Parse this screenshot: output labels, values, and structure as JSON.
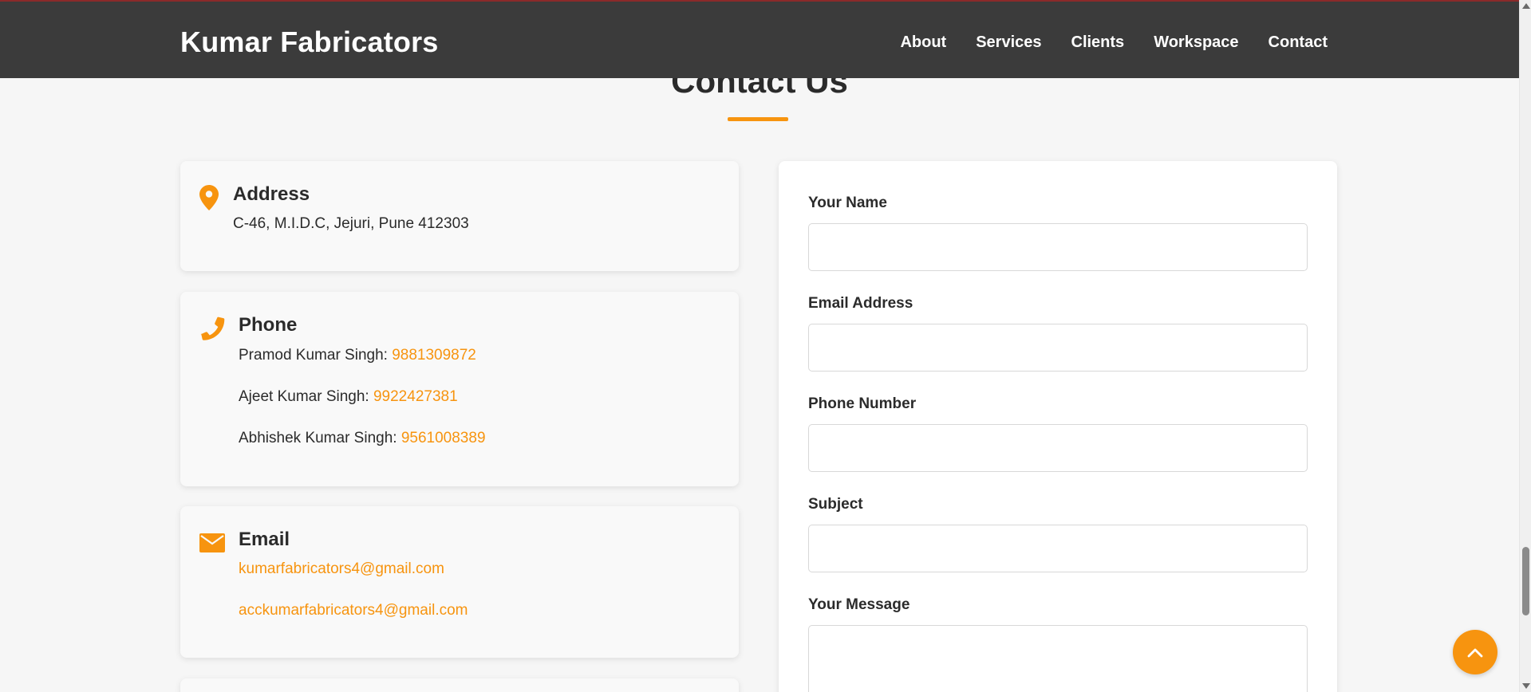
{
  "header": {
    "brand": "Kumar Fabricators",
    "nav": [
      "About",
      "Services",
      "Clients",
      "Workspace",
      "Contact"
    ]
  },
  "section": {
    "title": "Contact Us"
  },
  "address": {
    "title": "Address",
    "text": "C-46, M.I.D.C, Jejuri, Pune 412303"
  },
  "phone": {
    "title": "Phone",
    "entries": [
      {
        "name": "Pramod Kumar Singh:",
        "number": "9881309872"
      },
      {
        "name": "Ajeet Kumar Singh:",
        "number": "9922427381"
      },
      {
        "name": "Abhishek Kumar Singh:",
        "number": "9561008389"
      }
    ]
  },
  "email": {
    "title": "Email",
    "addresses": [
      "kumarfabricators4@gmail.com",
      "acckumarfabricators4@gmail.com"
    ]
  },
  "form": {
    "name_label": "Your Name",
    "email_label": "Email Address",
    "phone_label": "Phone Number",
    "subject_label": "Subject",
    "message_label": "Your Message",
    "name_value": "",
    "email_value": "",
    "phone_value": "",
    "subject_value": "",
    "message_value": ""
  },
  "icons": {
    "address": "map-pin-icon",
    "phone": "phone-icon",
    "email": "envelope-icon",
    "back_to_top": "chevron-up-icon"
  },
  "colors": {
    "accent": "#f7940f",
    "navbar": "#3b3b3b",
    "page_bg": "#f6f6f6",
    "text": "#2b2b2b"
  }
}
